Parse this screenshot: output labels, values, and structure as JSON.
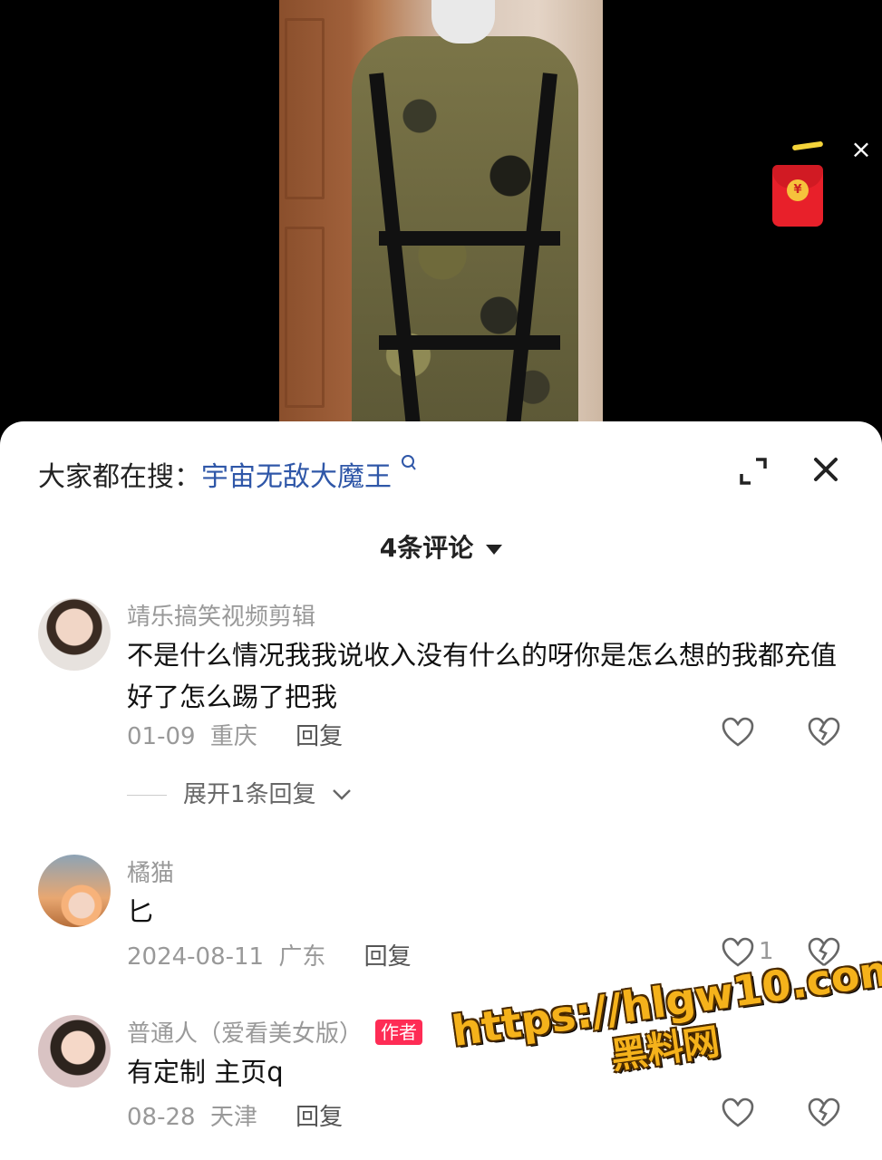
{
  "video": {
    "close_glyph": "×",
    "redpacket_glyph": "¥"
  },
  "panel": {
    "search_prefix": "大家都在搜：",
    "search_term": "宇宙无敌大魔王",
    "search_icon": "search-icon",
    "comment_count": "4条评论"
  },
  "comments": [
    {
      "user": "靖乐搞笑视频剪辑",
      "text": "不是什么情况我我说收入没有什么的呀你是怎么想的我都充值好了怎么踢了把我",
      "date": "01-09",
      "location": "重庆",
      "reply_label": "回复",
      "expand_label": "展开1条回复"
    },
    {
      "user": "橘猫",
      "text": "匕",
      "date": "2024-08-11",
      "location": "广东",
      "reply_label": "回复",
      "like_count": "1"
    },
    {
      "user": "普通人（爱看美女版）",
      "author_tag": "作者",
      "text": "有定制 主页q",
      "date": "08-28",
      "location": "天津",
      "reply_label": "回复"
    }
  ],
  "watermark": {
    "line1": "https://hlgw10.com",
    "line2": "黑料网"
  }
}
